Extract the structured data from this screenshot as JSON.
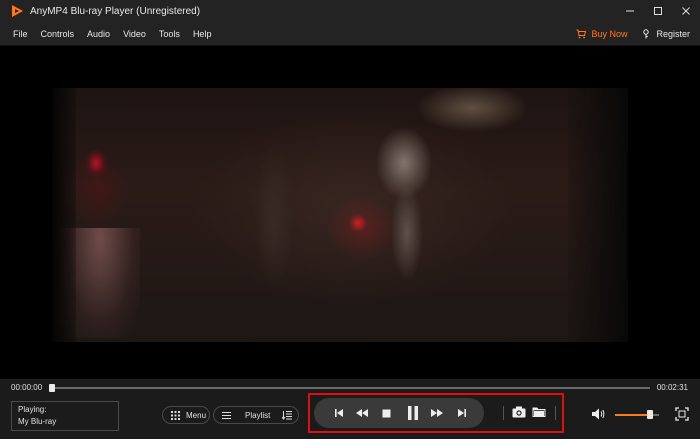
{
  "window": {
    "title": "AnyMP4 Blu-ray Player (Unregistered)",
    "icons": [
      "app-logo-icon",
      "minimize-icon",
      "maximize-icon",
      "close-icon"
    ]
  },
  "menubar": {
    "items": [
      "File",
      "Controls",
      "Audio",
      "Video",
      "Tools",
      "Help"
    ],
    "buy_now": "Buy Now",
    "register": "Register",
    "accent": "#ff7a1a"
  },
  "player": {
    "current_time": "00:00:00",
    "total_time": "00:02:31",
    "seek_progress_percent": 0,
    "now_playing_label": "Playing:",
    "now_playing_title": "My Blu-ray",
    "menu_label": "Menu",
    "playlist_label": "Playlist",
    "volume_percent": 80,
    "highlight_color": "#e01010",
    "transport_icons": [
      "skip-previous-icon",
      "rewind-icon",
      "stop-icon",
      "pause-icon",
      "fast-forward-icon",
      "skip-next-icon"
    ]
  }
}
